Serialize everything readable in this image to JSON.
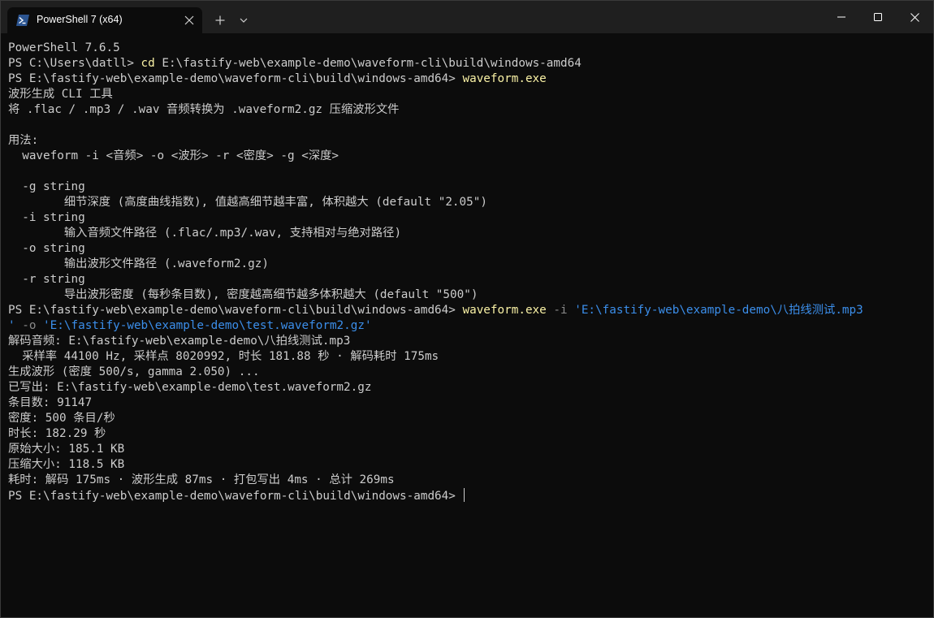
{
  "window": {
    "tab_title": "PowerShell 7 (x64)",
    "tab_icon": "powershell-icon",
    "new_tab_icon": "plus-icon",
    "dropdown_icon": "chevron-down-icon",
    "minimize_icon": "minimize-icon",
    "maximize_icon": "maximize-icon",
    "close_icon": "close-icon"
  },
  "colors": {
    "background": "#0c0c0c",
    "titlebar": "#1f1f1f",
    "text": "#cccccc",
    "command": "#f9f1a5",
    "parameter": "#8a8a8a",
    "string": "#3b8eea"
  },
  "terminal": {
    "lines": [
      [
        {
          "text": "PowerShell 7.6.5"
        }
      ],
      [
        {
          "text": "PS C:\\Users\\datll> "
        },
        {
          "text": "cd",
          "style": "yellow"
        },
        {
          "text": " E:\\fastify-web\\example-demo\\waveform-cli\\build\\windows-amd64"
        }
      ],
      [
        {
          "text": "PS E:\\fastify-web\\example-demo\\waveform-cli\\build\\windows-amd64> "
        },
        {
          "text": "waveform.exe",
          "style": "yellow"
        }
      ],
      [
        {
          "text": "波形生成 CLI 工具"
        }
      ],
      [
        {
          "text": "将 .flac / .mp3 / .wav 音频转换为 .waveform2.gz 压缩波形文件"
        }
      ],
      [
        {
          "text": ""
        }
      ],
      [
        {
          "text": "用法:"
        }
      ],
      [
        {
          "text": "  waveform -i <音频> -o <波形> -r <密度> -g <深度>"
        }
      ],
      [
        {
          "text": ""
        }
      ],
      [
        {
          "text": "  -g string"
        }
      ],
      [
        {
          "text": "        细节深度 (高度曲线指数), 值越高细节越丰富, 体积越大 (default \"2.05\")"
        }
      ],
      [
        {
          "text": "  -i string"
        }
      ],
      [
        {
          "text": "        输入音频文件路径 (.flac/.mp3/.wav, 支持相对与绝对路径)"
        }
      ],
      [
        {
          "text": "  -o string"
        }
      ],
      [
        {
          "text": "        输出波形文件路径 (.waveform2.gz)"
        }
      ],
      [
        {
          "text": "  -r string"
        }
      ],
      [
        {
          "text": "        导出波形密度 (每秒条目数), 密度越高细节越多体积越大 (default \"500\")"
        }
      ],
      [
        {
          "text": "PS E:\\fastify-web\\example-demo\\waveform-cli\\build\\windows-amd64> "
        },
        {
          "text": "waveform.exe",
          "style": "yellow"
        },
        {
          "text": " -i",
          "style": "gray"
        },
        {
          "text": " 'E:\\fastify-web\\example-demo\\八拍线测试.mp3",
          "style": "blue"
        }
      ],
      [
        {
          "text": "'",
          "style": "blue"
        },
        {
          "text": " -o",
          "style": "gray"
        },
        {
          "text": " 'E:\\fastify-web\\example-demo\\test.waveform2.gz'",
          "style": "blue"
        }
      ],
      [
        {
          "text": "解码音频: E:\\fastify-web\\example-demo\\八拍线测试.mp3"
        }
      ],
      [
        {
          "text": "  采样率 44100 Hz, 采样点 8020992, 时长 181.88 秒 · 解码耗时 175ms"
        }
      ],
      [
        {
          "text": "生成波形 (密度 500/s, gamma 2.050) ..."
        }
      ],
      [
        {
          "text": "已写出: E:\\fastify-web\\example-demo\\test.waveform2.gz"
        }
      ],
      [
        {
          "text": "条目数: 91147"
        }
      ],
      [
        {
          "text": "密度: 500 条目/秒"
        }
      ],
      [
        {
          "text": "时长: 182.29 秒"
        }
      ],
      [
        {
          "text": "原始大小: 185.1 KB"
        }
      ],
      [
        {
          "text": "压缩大小: 118.5 KB"
        }
      ],
      [
        {
          "text": "耗时: 解码 175ms · 波形生成 87ms · 打包写出 4ms · 总计 269ms"
        }
      ],
      [
        {
          "text": "PS E:\\fastify-web\\example-demo\\waveform-cli\\build\\windows-amd64> "
        }
      ]
    ]
  }
}
